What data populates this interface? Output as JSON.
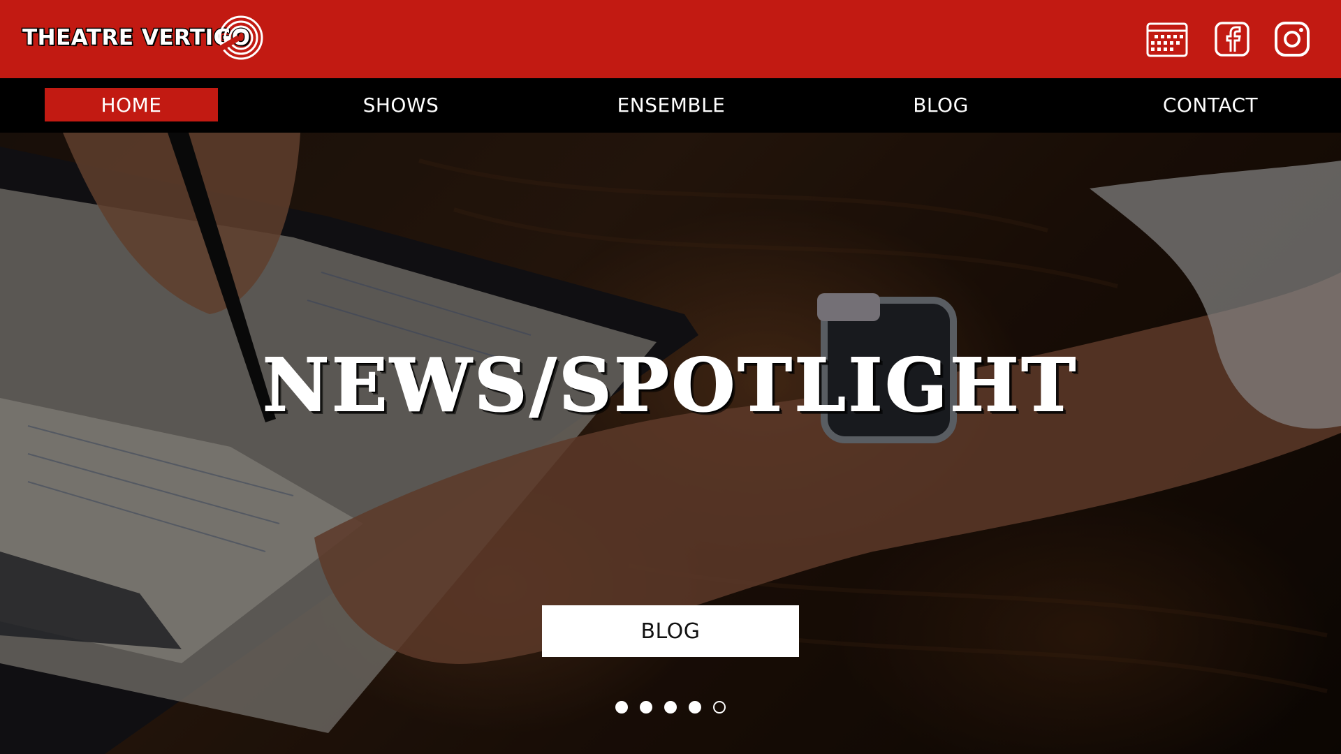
{
  "header": {
    "logo_text": "THEATRE VERTIGO",
    "icons": [
      {
        "name": "calendar-icon"
      },
      {
        "name": "facebook-icon"
      },
      {
        "name": "instagram-icon"
      }
    ],
    "colors": {
      "brand_red": "#c21a12",
      "nav_bg": "#000000"
    }
  },
  "nav": {
    "items": [
      {
        "label": "HOME",
        "active": true
      },
      {
        "label": "SHOWS",
        "active": false
      },
      {
        "label": "ENSEMBLE",
        "active": false
      },
      {
        "label": "BLOG",
        "active": false
      },
      {
        "label": "CONTACT",
        "active": false
      }
    ]
  },
  "hero": {
    "title": "NEWS/SPOTLIGHT",
    "button_label": "BLOG",
    "slides_total": 5,
    "active_slide": 5
  }
}
